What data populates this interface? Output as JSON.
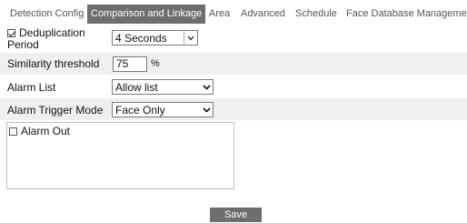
{
  "tabs": [
    {
      "label": "Detection Config",
      "active": false
    },
    {
      "label": "Comparison and Linkage",
      "active": true
    },
    {
      "label": "Area",
      "active": false
    },
    {
      "label": "Advanced",
      "active": false
    },
    {
      "label": "Schedule",
      "active": false
    },
    {
      "label": "Face Database Management",
      "active": false
    }
  ],
  "form": {
    "dedup": {
      "label_line1": "Deduplication",
      "label_line2": "Period",
      "checked": true,
      "value": "4 Seconds"
    },
    "similarity": {
      "label": "Similarity threshold",
      "value": "75",
      "unit": "%"
    },
    "alarm_list": {
      "label": "Alarm List",
      "value": "Allow list"
    },
    "trigger_mode": {
      "label": "Alarm Trigger Mode",
      "value": "Face Only"
    },
    "alarm_out": {
      "label": "Alarm Out",
      "checked": false
    }
  },
  "save_label": "Save",
  "colors": {
    "tab_active_bg": "#6e6e6e",
    "row_shade": "#efefef",
    "button_bg": "#6e6e6e"
  },
  "icons": [
    "checkbox-checked-icon",
    "checkbox-unchecked-icon",
    "chevron-down-icon"
  ]
}
